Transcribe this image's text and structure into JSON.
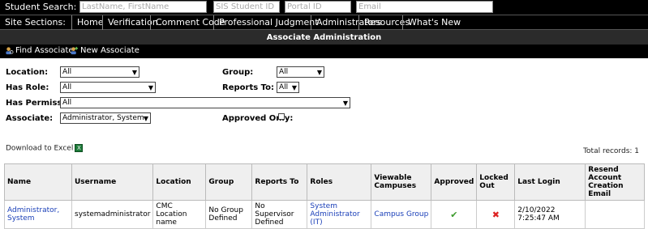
{
  "search": {
    "label": "Student Search:",
    "name_placeholder": "LastName, FirstName",
    "sis_placeholder": "SIS Student ID",
    "portal_placeholder": "Portal ID",
    "email_placeholder": "Email"
  },
  "nav": {
    "label": "Site Sections:",
    "items": [
      "Home",
      "Verification",
      "Comment Code",
      "Professional Judgment",
      "Administrators",
      "Resources",
      "What's New"
    ]
  },
  "page_title": "Associate Administration",
  "toolbar": {
    "find_label": "Find Associate",
    "new_label": "New Associate"
  },
  "filters": {
    "location_label": "Location:",
    "location_value": "All",
    "group_label": "Group:",
    "group_value": "All",
    "role_label": "Has Role:",
    "role_value": "All",
    "reports_label": "Reports To:",
    "reports_value": "All",
    "permission_label": "Has Permission:",
    "permission_value": "All",
    "associate_label": "Associate:",
    "associate_value": "Administrator, System",
    "approved_label": "Approved Only:"
  },
  "download_label": "Download to Excel",
  "total_records": "Total records: 1",
  "table": {
    "headers": [
      "Name",
      "Username",
      "Location",
      "Group",
      "Reports To",
      "Roles",
      "Viewable Campuses",
      "Approved",
      "Locked Out",
      "Last Login",
      "Resend Account Creation Email"
    ],
    "rows": [
      {
        "name": "Administrator, System",
        "username": "systemadministrator",
        "location": "CMC Location name",
        "group": "No Group Defined",
        "reports_to": "No Supervisor Defined",
        "roles": "System Administrator (IT)",
        "campuses": "Campus Group",
        "approved": "check",
        "locked_out": "x",
        "last_login": "2/10/2022 7:25:47 AM",
        "resend": ""
      }
    ]
  },
  "colors": {
    "approved": "#3c9a2c",
    "locked": "#dd2222",
    "link": "#1a3fb8"
  }
}
